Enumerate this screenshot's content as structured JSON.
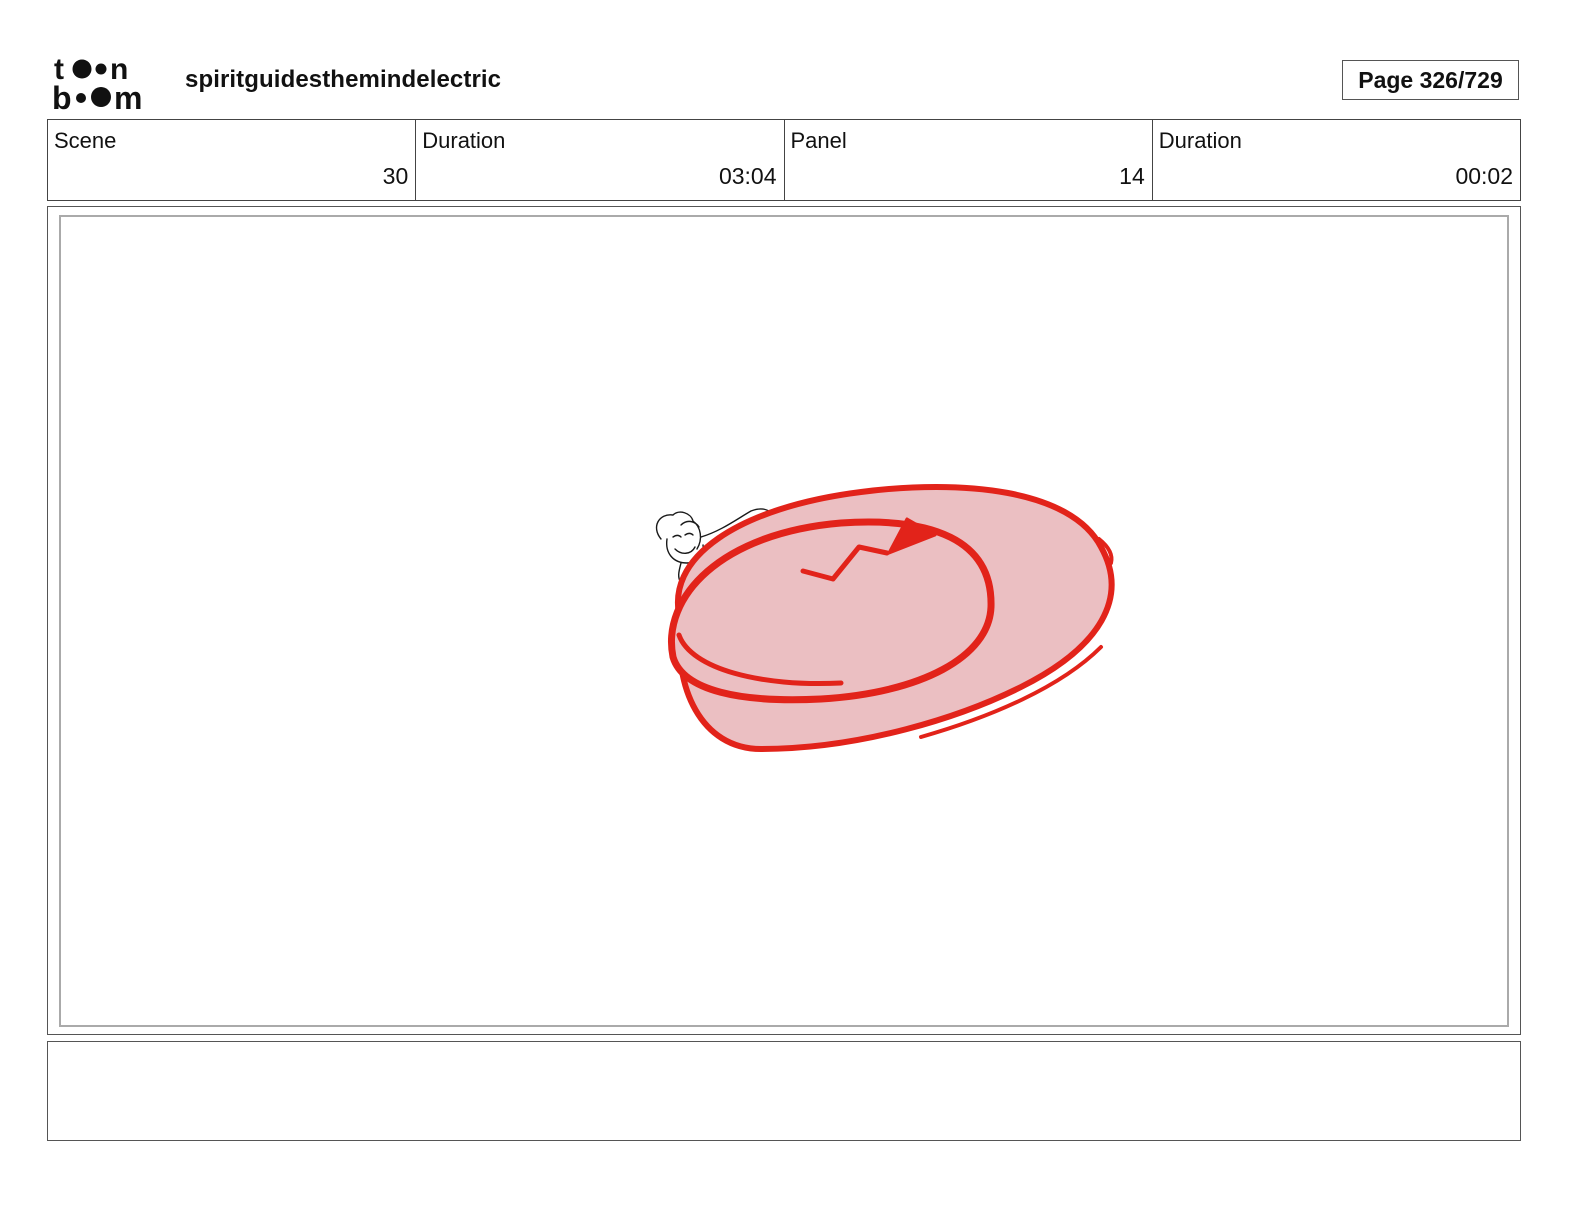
{
  "header": {
    "logo": {
      "line1": "toon",
      "line2": "boom",
      "icon": "toon-boom-logo"
    },
    "project_title": "spiritguidesthemindelectric",
    "page_label": "Page 326/729"
  },
  "info": {
    "scene_label": "Scene",
    "scene_value": "30",
    "scene_duration_label": "Duration",
    "scene_duration_value": "03:04",
    "panel_label": "Panel",
    "panel_value": "14",
    "panel_duration_label": "Duration",
    "panel_duration_value": "00:02"
  },
  "panel": {
    "sketch": "red-disc-with-character-sketch",
    "colors": {
      "stroke": "#e2231a",
      "fill": "#ebbfc2",
      "ink": "#1a1a1a"
    }
  },
  "notes": {
    "text": ""
  }
}
